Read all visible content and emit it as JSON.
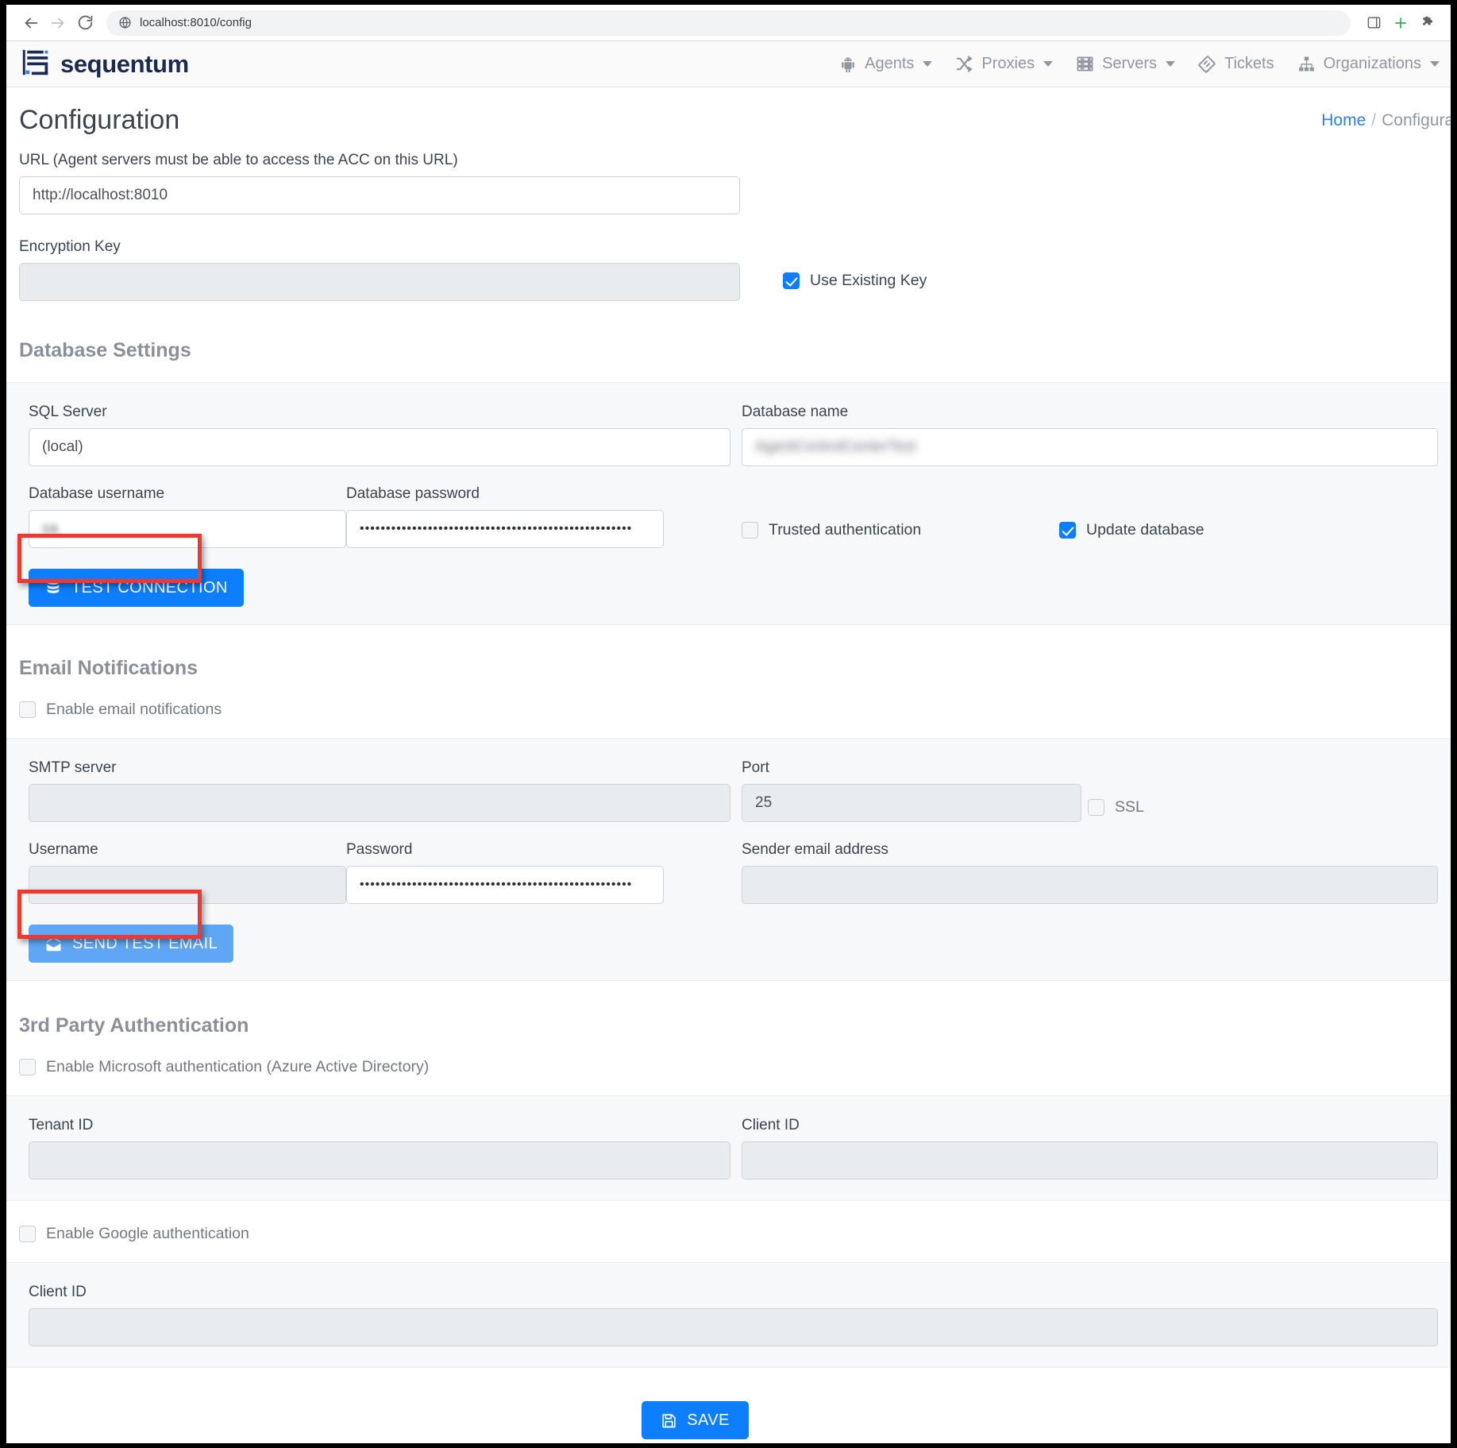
{
  "browser": {
    "url": "localhost:8010/config",
    "back_icon": "back-arrow-icon",
    "forward_icon": "forward-arrow-icon",
    "reload_icon": "reload-icon",
    "site_icon": "globe-icon",
    "sidepanel_icon": "side-panel-icon",
    "extension_add_icon": "add-extension-icon",
    "extensions_icon": "puzzle-piece-icon"
  },
  "navbar": {
    "brand": "sequentum",
    "items": [
      {
        "label": "Agents",
        "icon": "android-robot-icon",
        "caret": true
      },
      {
        "label": "Proxies",
        "icon": "shuffle-icon",
        "caret": true
      },
      {
        "label": "Servers",
        "icon": "server-rack-icon",
        "caret": true
      },
      {
        "label": "Tickets",
        "icon": "ticket-icon",
        "caret": false
      },
      {
        "label": "Organizations",
        "icon": "org-chart-icon",
        "caret": true
      }
    ]
  },
  "page": {
    "title": "Configuration",
    "breadcrumb_home": "Home",
    "breadcrumb_sep": "/",
    "breadcrumb_current": "Configurat"
  },
  "url_section": {
    "label": "URL (Agent servers must be able to access the ACC on this URL)",
    "value": "http://localhost:8010"
  },
  "encryption": {
    "label": "Encryption Key",
    "value": "",
    "use_existing_key_label": "Use Existing Key",
    "use_existing_key_checked": true
  },
  "database": {
    "section_title": "Database Settings",
    "sql_server_label": "SQL Server",
    "sql_server_value": "(local)",
    "database_name_label": "Database name",
    "database_name_value": "AgentControlCenterTest",
    "username_label": "Database username",
    "username_value": "sa",
    "password_label": "Database password",
    "password_value": "••••••••••••••••••••••••••••••••••••••••••••••••••••",
    "trusted_auth_label": "Trusted authentication",
    "trusted_auth_checked": false,
    "update_db_label": "Update database",
    "update_db_checked": true,
    "test_connection_label": "TEST CONNECTION",
    "test_connection_icon": "database-icon"
  },
  "email": {
    "section_title": "Email Notifications",
    "enable_label": "Enable email notifications",
    "enable_checked": false,
    "smtp_label": "SMTP server",
    "smtp_value": "",
    "port_label": "Port",
    "port_value": "25",
    "ssl_label": "SSL",
    "ssl_checked": false,
    "username_label": "Username",
    "username_value": "",
    "password_label": "Password",
    "password_value": "••••••••••••••••••••••••••••••••••••••••••••••••••••",
    "sender_label": "Sender email address",
    "sender_value": "",
    "send_test_label": "SEND TEST EMAIL",
    "send_test_icon": "envelope-open-icon"
  },
  "third_party": {
    "section_title": "3rd Party Authentication",
    "ms_enable_label": "Enable Microsoft authentication (Azure Active Directory)",
    "ms_enable_checked": false,
    "tenant_id_label": "Tenant ID",
    "tenant_id_value": "",
    "ms_client_id_label": "Client ID",
    "ms_client_id_value": "",
    "google_enable_label": "Enable Google authentication",
    "google_enable_checked": false,
    "google_client_id_label": "Client ID",
    "google_client_id_value": ""
  },
  "footer": {
    "save_label": "SAVE",
    "save_icon": "floppy-disk-icon"
  },
  "colors": {
    "primary": "#0d7efd",
    "primary_soft": "#5fa7f5",
    "annotation": "#f4372e",
    "link": "#2f7ff0",
    "section_heading": "#8a9099"
  }
}
